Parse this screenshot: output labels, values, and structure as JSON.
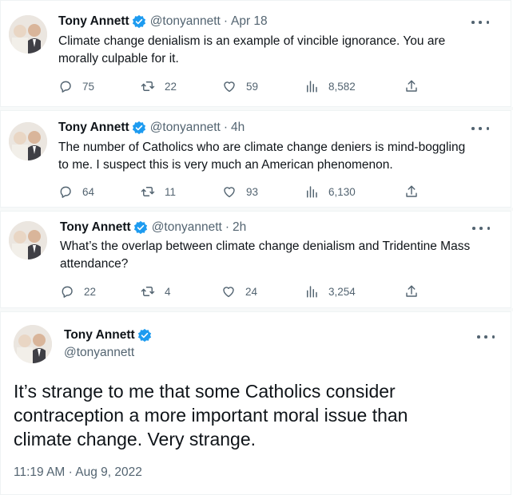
{
  "colors": {
    "verified": "#1d9bf0",
    "text": "#0f1419",
    "muted": "#536471"
  },
  "tweets": [
    {
      "name": "Tony Annett",
      "handle": "@tonyannett",
      "separator": "·",
      "time": "Apr 18",
      "text": "Climate change denialism is an example of vincible ignorance. You are morally culpable for it.",
      "replies": "75",
      "retweets": "22",
      "likes": "59",
      "views": "8,582"
    },
    {
      "name": "Tony Annett",
      "handle": "@tonyannett",
      "separator": "·",
      "time": "4h",
      "text": "The number of Catholics who are climate change deniers is mind-boggling to me. I suspect this is very much an American phenomenon.",
      "replies": "64",
      "retweets": "11",
      "likes": "93",
      "views": "6,130"
    },
    {
      "name": "Tony Annett",
      "handle": "@tonyannett",
      "separator": "·",
      "time": "2h",
      "text": "What’s the overlap between climate change denialism and Tridentine Mass attendance?",
      "replies": "22",
      "retweets": "4",
      "likes": "24",
      "views": "3,254"
    }
  ],
  "featured": {
    "name": "Tony Annett",
    "handle": "@tonyannett",
    "text": "It’s strange to me that some Catholics consider contraception a more important moral issue than climate change. Very strange.",
    "timestamp": "11:19 AM · Aug 9, 2022"
  }
}
